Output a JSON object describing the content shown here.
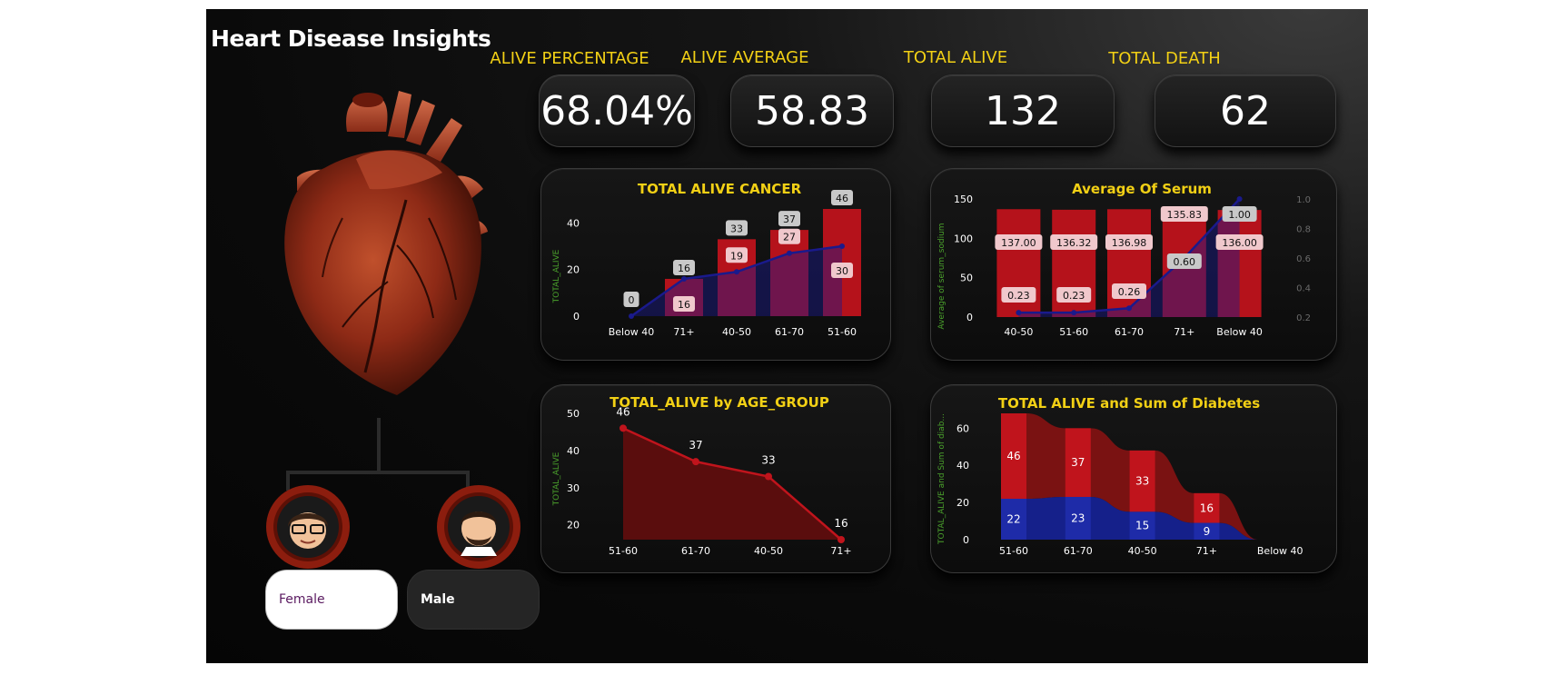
{
  "dashboard": {
    "title": "Heart Disease Insights",
    "kpis": [
      {
        "label": "ALIVE PERCENTAGE",
        "value": "68.04%"
      },
      {
        "label": "ALIVE AVERAGE",
        "value": "58.83"
      },
      {
        "label": "TOTAL ALIVE",
        "value": "132"
      },
      {
        "label": "TOTAL DEATH",
        "value": "62"
      }
    ],
    "gender_buttons": {
      "female": "Female",
      "male": "Male"
    },
    "colors": {
      "accent_yellow": "#f2d015",
      "bar_red": "#b5121b",
      "line_blue": "#1a1a8c",
      "axis_green": "#4aa02c",
      "background": "#0a0a0a"
    }
  },
  "chart_data": [
    {
      "type": "bar",
      "title": "TOTAL ALIVE CANCER",
      "ylabel": "TOTAL_ALIVE",
      "categories": [
        "Below 40",
        "71+",
        "40-50",
        "61-70",
        "51-60"
      ],
      "yticks": [
        0,
        20,
        40
      ],
      "ylim": [
        0,
        46
      ],
      "series": [
        {
          "values": [
            0,
            16,
            33,
            37,
            46
          ],
          "labels": [
            "",
            "16",
            "33",
            "37",
            "46"
          ]
        },
        {
          "values": [
            0,
            16,
            19,
            27,
            30
          ],
          "labels": [
            "0",
            "16",
            "19",
            "27",
            "30"
          ]
        }
      ]
    },
    {
      "type": "bar",
      "title": "Average Of Serum",
      "ylabel": "Average of serum_sodium",
      "categories": [
        "40-50",
        "51-60",
        "61-70",
        "71+",
        "Below 40"
      ],
      "yticks": [
        0,
        50,
        100,
        150
      ],
      "ylim": [
        0,
        150
      ],
      "y2ticks": [
        "0.2",
        "0.4",
        "0.6",
        "0.8",
        "1.0"
      ],
      "y2lim": [
        0.2,
        1.0
      ],
      "series": [
        {
          "values": [
            137.0,
            136.32,
            136.98,
            135.83,
            136.0
          ],
          "labels": [
            "137.00",
            "136.32",
            "136.98",
            "135.83",
            "136.00"
          ]
        },
        {
          "values": [
            0.23,
            0.23,
            0.26,
            0.6,
            1.0
          ],
          "labels": [
            "0.23",
            "0.23",
            "0.26",
            "0.60",
            "1.00"
          ]
        }
      ]
    },
    {
      "type": "area",
      "title": "TOTAL_ALIVE by AGE_GROUP",
      "ylabel": "TOTAL_ALIVE",
      "categories": [
        "51-60",
        "61-70",
        "40-50",
        "71+"
      ],
      "values": [
        46,
        37,
        33,
        16
      ],
      "labels": [
        "46",
        "37",
        "33",
        "16"
      ],
      "yticks": [
        20,
        30,
        40,
        50
      ],
      "ylim": [
        16,
        50
      ]
    },
    {
      "type": "bar",
      "title": "TOTAL ALIVE and Sum of Diabetes",
      "ylabel": "TOTAL_ALIVE and Sum of diab...",
      "categories": [
        "51-60",
        "61-70",
        "40-50",
        "71+",
        "Below 40"
      ],
      "yticks": [
        0,
        20,
        40,
        60
      ],
      "ylim": [
        0,
        68
      ],
      "series": [
        {
          "values": [
            46,
            37,
            33,
            16,
            0
          ],
          "labels": [
            "46",
            "37",
            "33",
            "16",
            ""
          ]
        },
        {
          "values": [
            22,
            23,
            15,
            9,
            0
          ],
          "labels": [
            "22",
            "23",
            "15",
            "9",
            ""
          ]
        }
      ]
    }
  ]
}
